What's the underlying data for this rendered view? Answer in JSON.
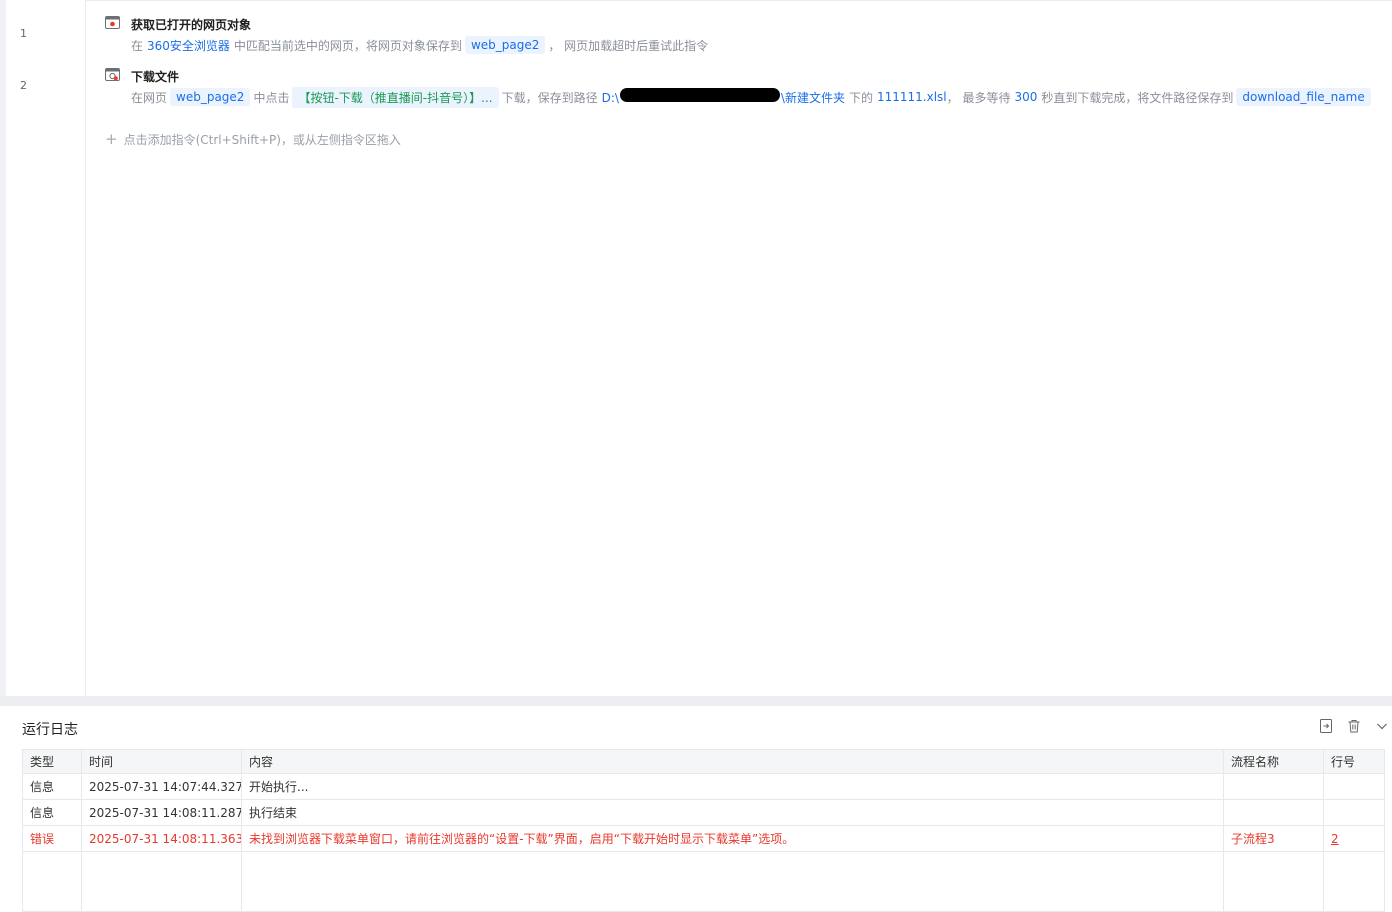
{
  "lines": [
    "1",
    "2"
  ],
  "steps": [
    {
      "title": "获取已打开的网页对象",
      "desc": {
        "p1": "在",
        "browser": "360安全浏览器",
        "p2": "中匹配当前选中的网页，将网页对象保存到",
        "var": "web_page2",
        "p3": "， 网页加载超时后重试此指令"
      }
    },
    {
      "title": "下载文件",
      "desc": {
        "p1": "在网页",
        "var": "web_page2",
        "p2": "中点击",
        "element": "【按钮-下载（推直播间-抖音号）】...",
        "p3": "下载，保存到路径",
        "path_prefix": "D:\\",
        "path_suffix": "\\新建文件夹",
        "p4": "下的",
        "filename": "111111.xlsl",
        "p5": "， 最多等待",
        "seconds": "300",
        "p6": "秒直到下载完成，将文件路径保存到",
        "out_var": "download_file_name"
      }
    }
  ],
  "add_command_hint": "点击添加指令(Ctrl+Shift+P)，或从左侧指令区拖入",
  "log": {
    "title": "运行日志",
    "columns": [
      "类型",
      "时间",
      "内容",
      "流程名称",
      "行号"
    ],
    "rows": [
      {
        "type": "信息",
        "time": "2025-07-31 14:07:44.327",
        "content": "开始执行...",
        "flow": "",
        "line": ""
      },
      {
        "type": "信息",
        "time": "2025-07-31 14:08:11.287",
        "content": "执行结束",
        "flow": "",
        "line": ""
      },
      {
        "type": "错误",
        "time": "2025-07-31 14:08:11.363",
        "content": "未找到浏览器下载菜单窗口，请前往浏览器的“设置-下载”界面，启用“下载开始时显示下载菜单”选项。",
        "flow": "子流程3",
        "line": "2"
      }
    ]
  },
  "colors": {
    "accent": "#1b6ee8",
    "error": "#e8382c",
    "element_green": "#1a9a52"
  },
  "icons": [
    "browser-open-icon",
    "download-file-icon",
    "plus-icon",
    "export-log-icon",
    "trash-icon",
    "chevron-down-icon"
  ]
}
